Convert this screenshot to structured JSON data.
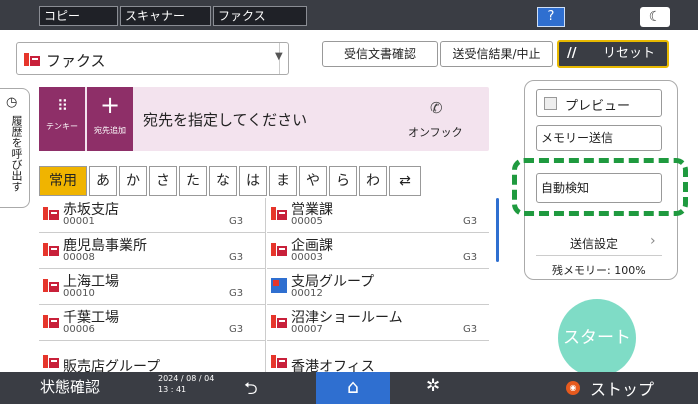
{
  "top_tabs": [
    "コピー",
    "スキャナー",
    "ファクス"
  ],
  "help_label": "?",
  "theme_icon": "moon-icon",
  "mode_select": {
    "value": "ファクス"
  },
  "header_buttons": {
    "received_check": "受信文書確認",
    "send_result": "送受信結果/中止",
    "reset": "リセット"
  },
  "history_tab": "履歴を呼び出す",
  "tenkey_label": "テンキー",
  "add_dest_label": "宛先追加",
  "dest_prompt": "宛先を指定してください",
  "onhook_label": "オンフック",
  "index_tabs": [
    "常用",
    "あ",
    "か",
    "さ",
    "た",
    "な",
    "は",
    "ま",
    "や",
    "ら",
    "わ"
  ],
  "entries_left": [
    {
      "name": "赤坂支店",
      "num": "00001",
      "line": "G3"
    },
    {
      "name": "鹿児島事業所",
      "num": "00008",
      "line": "G3"
    },
    {
      "name": "上海工場",
      "num": "00010",
      "line": "G3"
    },
    {
      "name": "千葉工場",
      "num": "00006",
      "line": "G3"
    },
    {
      "name": "販売店グループ",
      "num": "",
      "line": ""
    }
  ],
  "entries_right": [
    {
      "name": "営業課",
      "num": "00005",
      "line": "G3"
    },
    {
      "name": "企画課",
      "num": "00003",
      "line": "G3"
    },
    {
      "name": "支局グループ",
      "num": "00012",
      "line": ""
    },
    {
      "name": "沼津ショールーム",
      "num": "00007",
      "line": "G3"
    },
    {
      "name": "香港オフィス",
      "num": "",
      "line": ""
    }
  ],
  "right_panel": {
    "preview": "プレビュー",
    "memory_send": "メモリー送信",
    "auto_detect": "自動検知",
    "send_settings": "送信設定",
    "memory_remaining": "残メモリー:  100%"
  },
  "start_label": "スタート",
  "bottom": {
    "status": "状態確認",
    "date": "2024 / 08 / 04",
    "time": "13 : 41",
    "stop": "ストップ"
  },
  "colors": {
    "accent_purple": "#8e2f68",
    "highlight_green": "#1f9a3f",
    "reset_border": "#e8b900",
    "start": "#7fdcc6"
  }
}
